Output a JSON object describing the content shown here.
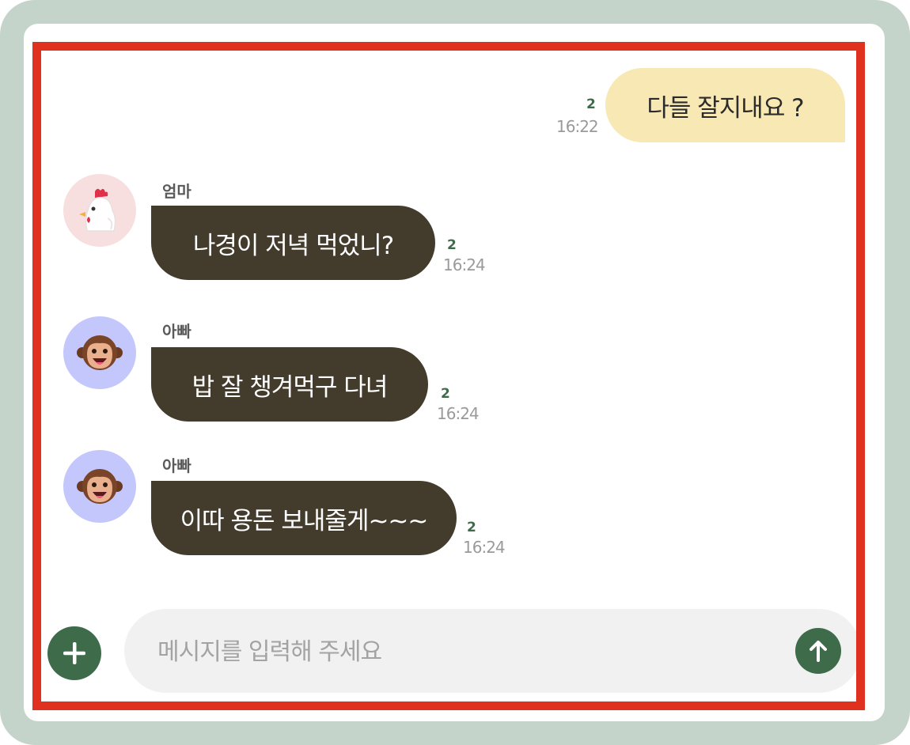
{
  "messages": [
    {
      "direction": "outgoing",
      "text": "다들 잘지내요 ?",
      "read_count": "2",
      "time": "16:22"
    },
    {
      "direction": "incoming",
      "sender": "엄마",
      "avatar_icon": "chicken-icon",
      "text": "나경이 저녁 먹었니?",
      "read_count": "2",
      "time": "16:24"
    },
    {
      "direction": "incoming",
      "sender": "아빠",
      "avatar_icon": "monkey-icon",
      "text": "밥 잘 챙겨먹구 다녀",
      "read_count": "2",
      "time": "16:24"
    },
    {
      "direction": "incoming",
      "sender": "아빠",
      "avatar_icon": "monkey-icon",
      "text": "이따 용돈 보내줄게~~~",
      "read_count": "2",
      "time": "16:24"
    }
  ],
  "composer": {
    "placeholder": "메시지를 입력해 주세요",
    "value": "",
    "attach_icon": "plus-icon",
    "send_icon": "arrow-up-icon"
  },
  "colors": {
    "accent": "#3e6b4a",
    "outgoing_bubble": "#f8e8b3",
    "incoming_bubble": "#433b2b",
    "highlight_border": "#e0301e",
    "frame": "#c5d4ca"
  }
}
